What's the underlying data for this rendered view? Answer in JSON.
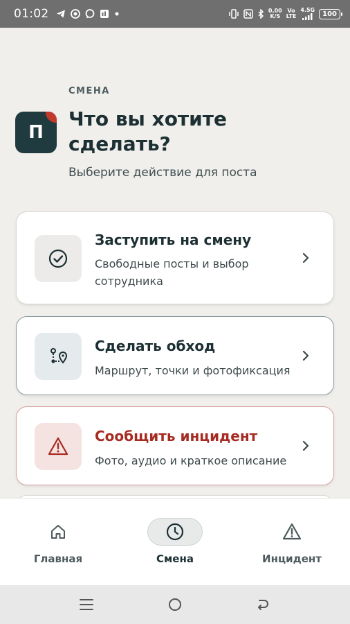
{
  "status_bar": {
    "time": "01:02",
    "net_speed_value": "0,00",
    "net_speed_unit": "K/S",
    "volte_top": "Vo",
    "volte_bottom": "LTE",
    "network": "4.5G",
    "battery": "100"
  },
  "header": {
    "eyebrow": "СМЕНА",
    "logo_letter": "П",
    "title": "Что вы хотите сделать?",
    "subtitle": "Выберите действие для поста"
  },
  "actions": [
    {
      "title": "Заступить на смену",
      "description": "Свободные посты и выбор сотрудника",
      "icon": "check-circle-icon"
    },
    {
      "title": "Сделать обход",
      "description": "Маршрут, точки и фотофиксация",
      "icon": "route-icon"
    },
    {
      "title": "Сообщить инцидент",
      "description": "Фото, аудио и краткое описание",
      "icon": "warning-icon"
    }
  ],
  "nav": [
    {
      "label": "Главная",
      "icon": "home-icon"
    },
    {
      "label": "Смена",
      "icon": "clock-icon",
      "active": true
    },
    {
      "label": "Инцидент",
      "icon": "warning-icon"
    }
  ],
  "colors": {
    "accent": "#1f3b40",
    "danger": "#a62b22",
    "background": "#f1efec"
  }
}
